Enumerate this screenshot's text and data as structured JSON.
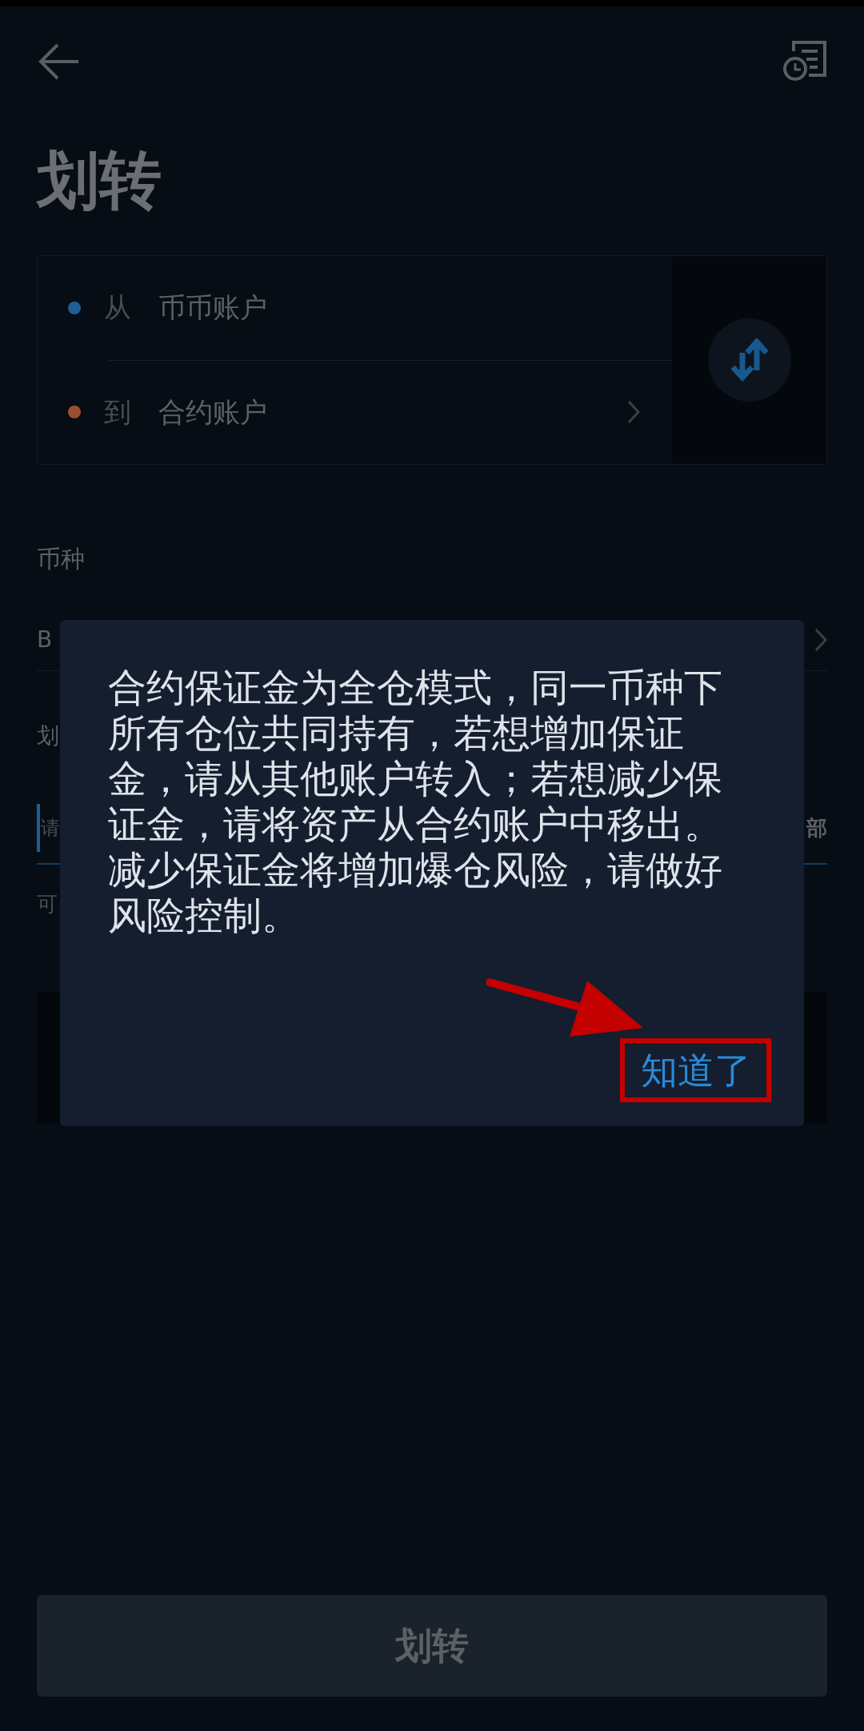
{
  "header": {
    "title": "划转"
  },
  "transfer": {
    "from": {
      "prefix": "从",
      "account": "币币账户",
      "color": "#1d5f95"
    },
    "to": {
      "prefix": "到",
      "account": "合约账户",
      "color": "#9a4f2e"
    }
  },
  "coin": {
    "label": "币种",
    "value": "B"
  },
  "amount": {
    "label": "划",
    "placeholder": "请",
    "action": "部",
    "available": "可"
  },
  "dialog": {
    "message": "合约保证金为全仓模式，同一币种下所有仓位共同持有，若想增加保证金，请从其他账户转入；若想减少保证金，请将资产从合约账户中移出。减少保证金将增加爆仓风险，请做好风险控制。",
    "confirm": "知道了"
  },
  "submit": "划转"
}
